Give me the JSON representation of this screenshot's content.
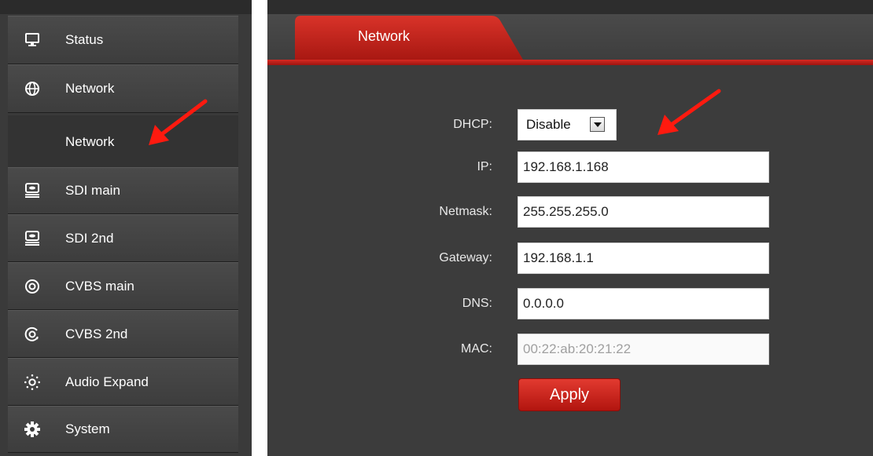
{
  "sidebar": {
    "items": [
      {
        "label": "Status",
        "icon": "monitor-icon"
      },
      {
        "label": "Network",
        "icon": "globe-icon"
      },
      {
        "label": "SDI main",
        "icon": "sdi-icon"
      },
      {
        "label": "SDI 2nd",
        "icon": "sdi-icon"
      },
      {
        "label": "CVBS main",
        "icon": "cvbs-icon"
      },
      {
        "label": "CVBS 2nd",
        "icon": "cvbs-icon"
      },
      {
        "label": "Audio Expand",
        "icon": "audio-icon"
      },
      {
        "label": "System",
        "icon": "gear-icon"
      }
    ],
    "subitem": {
      "label": "Network"
    }
  },
  "tab": {
    "label": "Network"
  },
  "form": {
    "dhcp": {
      "label": "DHCP:",
      "value": "Disable"
    },
    "ip": {
      "label": "IP:",
      "value": "192.168.1.168"
    },
    "netmask": {
      "label": "Netmask:",
      "value": "255.255.255.0"
    },
    "gateway": {
      "label": "Gateway:",
      "value": "192.168.1.1"
    },
    "dns": {
      "label": "DNS:",
      "value": "0.0.0.0"
    },
    "mac": {
      "label": "MAC:",
      "value": "00:22:ab:20:21:22"
    },
    "apply_label": "Apply"
  },
  "colors": {
    "accent": "#c8201a",
    "background": "#3c3c3c",
    "annotation_arrow": "#ff1a0f"
  }
}
